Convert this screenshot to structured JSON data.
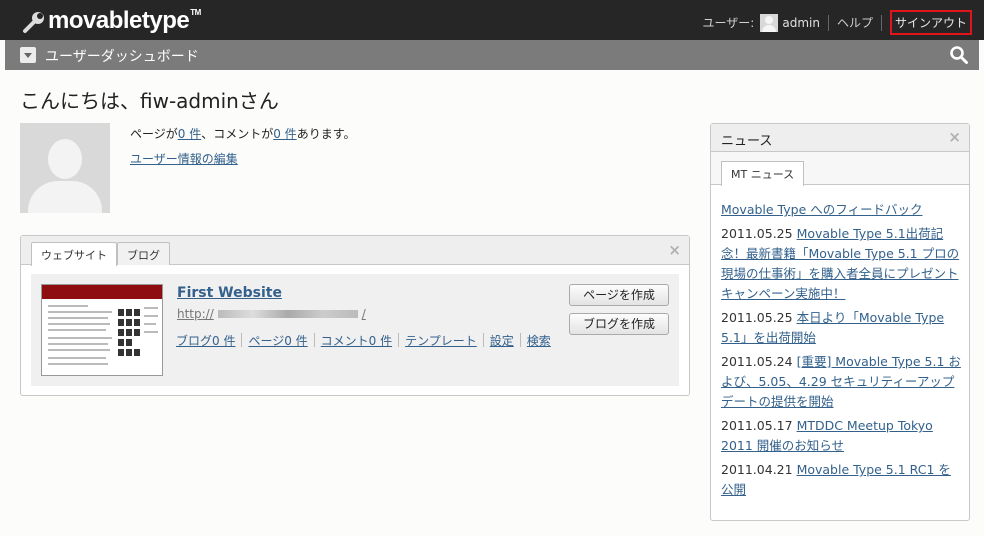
{
  "brand": {
    "name": "movabletype",
    "tm": "TM"
  },
  "usernav": {
    "user_label": "ユーザー:",
    "username": "admin",
    "help": "ヘルプ",
    "signout": "サインアウト"
  },
  "subbar": {
    "title": "ユーザーダッシュボード"
  },
  "greeting": "こんにちは、fiw-adminさん",
  "stats": {
    "prefix": "ページが",
    "pages": "0 件",
    "middle": "、コメントが",
    "comments": "0 件",
    "suffix": "あります。",
    "edit_user": "ユーザー情報の編集"
  },
  "site_widget": {
    "tabs": [
      "ウェブサイト",
      "ブログ"
    ],
    "close": "×",
    "site": {
      "name": "First Website",
      "url_prefix": "http://",
      "url_suffix": "/",
      "links": [
        "ブログ0 件",
        "ページ0 件",
        "コメント0 件",
        "テンプレート",
        "設定",
        "検索"
      ],
      "create_page": "ページを作成",
      "create_blog": "ブログを作成"
    }
  },
  "news_widget": {
    "title": "ニュース",
    "close": "×",
    "tab": "MT ニュース",
    "feedback_link": "Movable Type へのフィードバック",
    "items": [
      {
        "date": "2011.05.25",
        "text": "Movable Type 5.1出荷記念！最新書籍「Movable Type 5.1 プロの現場の仕事術」を購入者全員にプレゼントキャンペーン実施中！"
      },
      {
        "date": "2011.05.25",
        "text": "本日より「Movable Type 5.1」を出荷開始"
      },
      {
        "date": "2011.05.24",
        "text": "[重要] Movable Type 5.1 および、5.05、4.29 セキュリティーアップデートの提供を開始"
      },
      {
        "date": "2011.05.17",
        "text": "MTDDC Meetup Tokyo 2011 開催のお知らせ"
      },
      {
        "date": "2011.04.21",
        "text": "Movable Type 5.1 RC1 を公開"
      }
    ]
  },
  "colors": {
    "topbar": "#262626",
    "subbar": "#7b7b7b",
    "link": "#33618c",
    "signout_border": "#e0141a"
  }
}
